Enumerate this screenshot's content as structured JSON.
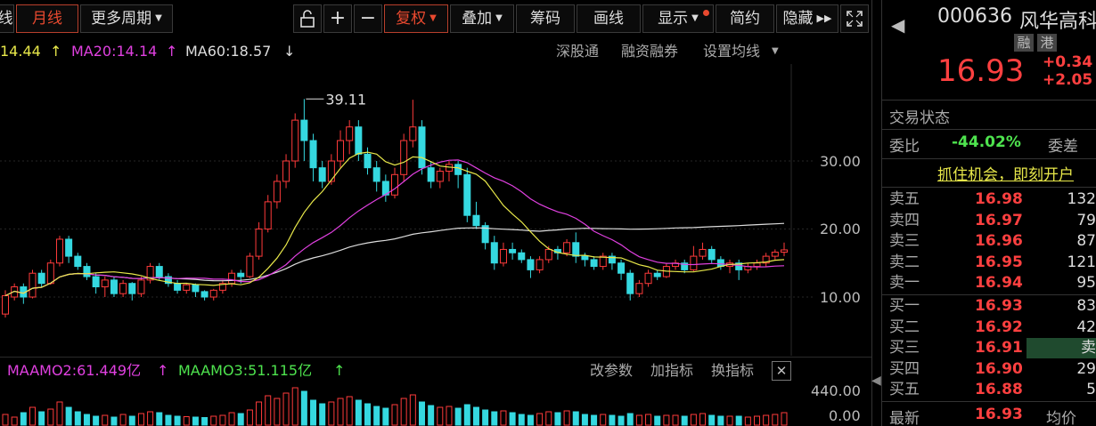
{
  "toolbar": {
    "period_partial": "线",
    "month": "月线",
    "more_periods": "更多周期",
    "zoom_in": "+",
    "zoom_out": "−",
    "restore": "复权",
    "overlay": "叠加",
    "chips": "筹码",
    "draw": "画线",
    "display": "显示",
    "summary": "简约",
    "hide": "隐藏"
  },
  "ma_legend": {
    "ma10": "14.44",
    "ma20": "MA20:14.14",
    "ma60": "MA60:18.57",
    "up_arrow": "↑",
    "down_arrow": "↓"
  },
  "chart_links": {
    "sz_connect": "深股通",
    "margin": "融资融券",
    "ma_settings": "设置均线"
  },
  "sub_legend": {
    "maamo2": "MAAMO2:61.449亿",
    "maamo3": "MAAMO3:51.115亿",
    "up_arrow": "↑",
    "change_params": "改参数",
    "add_indicator": "加指标",
    "switch_indicator": "换指标",
    "close": "✕"
  },
  "stock": {
    "code": "000636",
    "name": "风华高科",
    "tag_margin": "融",
    "tag_hk": "港",
    "price": "16.93",
    "change": "+0.34",
    "change_pct": "+2.05",
    "trade_status": "交易状态",
    "wei_bi_label": "委比",
    "wei_bi_value": "-44.02%",
    "wei_cha_label": "委差",
    "banner": "抓住机会，即刻开户",
    "latest_label": "最新",
    "latest_value": "16.93",
    "avg_label": "均价"
  },
  "order_book": {
    "asks": [
      {
        "label": "卖五",
        "price": "16.98",
        "vol": "132"
      },
      {
        "label": "卖四",
        "price": "16.97",
        "vol": "79"
      },
      {
        "label": "卖三",
        "price": "16.96",
        "vol": "87"
      },
      {
        "label": "卖二",
        "price": "16.95",
        "vol": "121"
      },
      {
        "label": "卖一",
        "price": "16.94",
        "vol": "95"
      }
    ],
    "bids": [
      {
        "label": "买一",
        "price": "16.93",
        "vol": "83"
      },
      {
        "label": "买二",
        "price": "16.92",
        "vol": "42"
      },
      {
        "label": "买三",
        "price": "16.91",
        "vol": "卖"
      },
      {
        "label": "买四",
        "price": "16.90",
        "vol": "29"
      },
      {
        "label": "买五",
        "price": "16.88",
        "vol": "5"
      }
    ]
  },
  "chart_data": {
    "type": "candlestick",
    "y_ticks": [
      "30.00",
      "20.00",
      "10.00"
    ],
    "sub_y_ticks": [
      "440.00",
      "0.00"
    ],
    "high_annotation": "39.11",
    "candles": [
      [
        7.5,
        10.2,
        7.0,
        11.0
      ],
      [
        10.0,
        11.5,
        9.5,
        12.0
      ],
      [
        11.5,
        10.0,
        9.0,
        12.0
      ],
      [
        10.0,
        13.5,
        9.8,
        14.0
      ],
      [
        13.5,
        12.0,
        11.5,
        14.0
      ],
      [
        12.0,
        15.0,
        11.8,
        15.5
      ],
      [
        15.0,
        18.5,
        14.5,
        19.0
      ],
      [
        18.5,
        16.0,
        15.0,
        19.0
      ],
      [
        16.0,
        14.5,
        14.0,
        16.5
      ],
      [
        14.5,
        13.0,
        12.5,
        15.0
      ],
      [
        13.0,
        11.5,
        10.5,
        13.5
      ],
      [
        11.5,
        12.5,
        10.0,
        13.0
      ],
      [
        12.5,
        10.5,
        10.0,
        13.0
      ],
      [
        10.5,
        12.0,
        10.0,
        12.5
      ],
      [
        12.0,
        10.5,
        9.5,
        12.2
      ],
      [
        10.5,
        12.5,
        10.0,
        13.0
      ],
      [
        12.5,
        14.5,
        12.0,
        15.0
      ],
      [
        14.5,
        13.0,
        12.5,
        15.0
      ],
      [
        13.0,
        12.0,
        11.5,
        13.5
      ],
      [
        12.0,
        11.0,
        10.5,
        12.5
      ],
      [
        11.0,
        11.8,
        10.5,
        12.0
      ],
      [
        11.8,
        10.8,
        10.0,
        12.0
      ],
      [
        10.8,
        10.0,
        9.5,
        11.0
      ],
      [
        10.0,
        11.0,
        9.5,
        11.2
      ],
      [
        11.0,
        12.0,
        10.5,
        12.5
      ],
      [
        12.0,
        13.5,
        11.5,
        14.0
      ],
      [
        13.5,
        13.0,
        12.0,
        14.0
      ],
      [
        13.0,
        16.0,
        12.8,
        16.5
      ],
      [
        16.0,
        20.0,
        15.5,
        21.0
      ],
      [
        20.0,
        24.0,
        19.5,
        25.0
      ],
      [
        24.0,
        27.0,
        23.0,
        28.0
      ],
      [
        27.0,
        30.0,
        26.0,
        31.0
      ],
      [
        30.0,
        36.0,
        29.0,
        37.0
      ],
      [
        36.0,
        33.0,
        30.0,
        39.11
      ],
      [
        33.0,
        29.0,
        27.0,
        34.0
      ],
      [
        29.0,
        27.0,
        26.0,
        30.0
      ],
      [
        27.0,
        30.0,
        26.5,
        31.0
      ],
      [
        30.0,
        33.0,
        29.0,
        34.5
      ],
      [
        33.0,
        35.0,
        31.0,
        36.0
      ],
      [
        35.0,
        31.0,
        30.0,
        36.0
      ],
      [
        31.0,
        29.0,
        28.0,
        32.0
      ],
      [
        29.0,
        27.0,
        25.5,
        30.0
      ],
      [
        27.0,
        25.0,
        24.0,
        28.0
      ],
      [
        25.0,
        28.0,
        24.5,
        29.0
      ],
      [
        28.0,
        33.0,
        27.0,
        34.0
      ],
      [
        33.0,
        35.0,
        32.0,
        39.0
      ],
      [
        35.0,
        29.0,
        28.0,
        36.0
      ],
      [
        29.0,
        27.0,
        26.0,
        30.0
      ],
      [
        27.0,
        28.5,
        26.0,
        29.0
      ],
      [
        28.5,
        29.5,
        27.0,
        30.0
      ],
      [
        29.5,
        28.0,
        26.0,
        30.0
      ],
      [
        28.0,
        22.0,
        21.0,
        29.0
      ],
      [
        22.0,
        20.5,
        20.0,
        24.0
      ],
      [
        20.5,
        18.0,
        17.0,
        21.0
      ],
      [
        18.0,
        15.0,
        14.0,
        19.0
      ],
      [
        15.0,
        17.0,
        14.5,
        18.0
      ],
      [
        17.0,
        16.5,
        15.5,
        18.0
      ],
      [
        16.5,
        15.5,
        15.0,
        17.0
      ],
      [
        15.5,
        14.0,
        12.8,
        16.0
      ],
      [
        14.0,
        15.5,
        13.5,
        16.0
      ],
      [
        15.5,
        17.0,
        15.0,
        17.5
      ],
      [
        17.0,
        16.5,
        15.5,
        17.5
      ],
      [
        16.5,
        18.0,
        16.0,
        18.5
      ],
      [
        18.0,
        16.0,
        15.0,
        19.5
      ],
      [
        16.0,
        15.5,
        14.5,
        16.5
      ],
      [
        15.5,
        14.5,
        14.0,
        16.0
      ],
      [
        14.5,
        16.0,
        14.0,
        16.5
      ],
      [
        16.0,
        15.0,
        14.0,
        16.5
      ],
      [
        15.0,
        13.5,
        12.5,
        15.5
      ],
      [
        13.5,
        10.5,
        9.5,
        14.0
      ],
      [
        10.5,
        12.0,
        10.0,
        12.5
      ],
      [
        12.0,
        13.5,
        11.5,
        14.0
      ],
      [
        13.5,
        13.0,
        12.5,
        14.0
      ],
      [
        13.0,
        14.5,
        12.8,
        15.0
      ],
      [
        14.5,
        15.0,
        14.0,
        15.5
      ],
      [
        15.0,
        14.0,
        13.5,
        15.5
      ],
      [
        14.0,
        16.0,
        13.8,
        17.5
      ],
      [
        16.0,
        17.0,
        15.5,
        18.0
      ],
      [
        17.0,
        15.5,
        15.0,
        17.5
      ],
      [
        15.5,
        14.5,
        14.0,
        16.0
      ],
      [
        14.5,
        15.0,
        13.5,
        15.5
      ],
      [
        15.0,
        14.0,
        12.5,
        15.5
      ],
      [
        14.0,
        14.5,
        13.5,
        15.0
      ],
      [
        14.5,
        15.0,
        14.0,
        15.5
      ],
      [
        15.0,
        16.0,
        14.5,
        16.5
      ],
      [
        16.0,
        16.6,
        15.5,
        17.0
      ],
      [
        16.6,
        16.93,
        16.0,
        18.0
      ]
    ],
    "volumes": [
      120,
      90,
      140,
      200,
      150,
      180,
      260,
      200,
      150,
      120,
      100,
      110,
      90,
      120,
      100,
      130,
      150,
      140,
      110,
      100,
      95,
      90,
      85,
      100,
      110,
      140,
      130,
      170,
      260,
      330,
      300,
      360,
      420,
      380,
      280,
      240,
      260,
      300,
      320,
      280,
      240,
      210,
      190,
      230,
      300,
      340,
      260,
      220,
      200,
      210,
      190,
      230,
      200,
      170,
      150,
      160,
      140,
      120,
      110,
      130,
      150,
      140,
      160,
      150,
      120,
      110,
      120,
      110,
      100,
      130,
      110,
      120,
      100,
      110,
      110,
      100,
      120,
      130,
      110,
      100,
      100,
      100,
      90,
      100,
      110,
      120,
      140
    ]
  }
}
